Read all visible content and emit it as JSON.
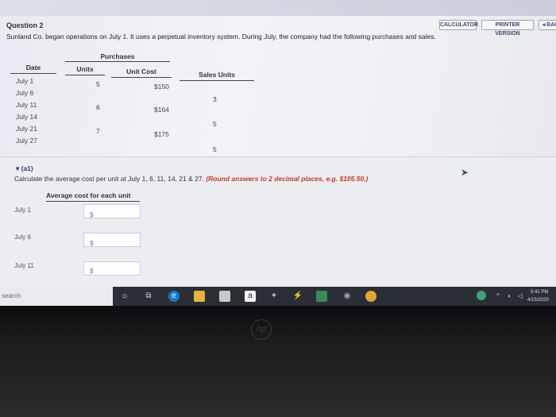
{
  "header": {
    "calculator_label": "CALCULATOR",
    "printer_label": "PRINTER VERSION",
    "back_label": "◂ BAC"
  },
  "question": {
    "title": "Question 2",
    "text": "Sunland Co. began operations on July 1. It uses a perpetual inventory system. During July, the company had the following purchases and sales."
  },
  "table": {
    "purchases_header": "Purchases",
    "date_header": "Date",
    "units_header": "Units",
    "unit_cost_header": "Unit Cost",
    "sales_units_header": "Sales Units",
    "rows": [
      {
        "date": "July   1",
        "units": "5",
        "unit_cost": "$150",
        "sales": ""
      },
      {
        "date": "July   6",
        "units": "",
        "unit_cost": "",
        "sales": "3"
      },
      {
        "date": "July   11",
        "units": "6",
        "unit_cost": "$164",
        "sales": ""
      },
      {
        "date": "July   14",
        "units": "",
        "unit_cost": "",
        "sales": "5"
      },
      {
        "date": "July   21",
        "units": "7",
        "unit_cost": "$175",
        "sales": ""
      },
      {
        "date": "July   27",
        "units": "",
        "unit_cost": "",
        "sales": "5"
      }
    ]
  },
  "part_a1": {
    "label": "▾ (a1)",
    "prompt": "Calculate the average cost per unit at July 1, 6, 11, 14, 21 & 27.",
    "hint": "(Round answers to 2 decimal places, e.g. $105.50.)",
    "column_header": "Average cost for each unit",
    "answers": [
      {
        "label": "July   1",
        "symbol": "$",
        "value": ""
      },
      {
        "label": "July   6",
        "symbol": "$",
        "value": ""
      },
      {
        "label": "July   11",
        "symbol": "$",
        "value": ""
      }
    ]
  },
  "taskbar": {
    "search_text": "search",
    "time": "9:42 PM",
    "date": "4/15/2020"
  },
  "laptop": {
    "brand_logo": "hp"
  }
}
